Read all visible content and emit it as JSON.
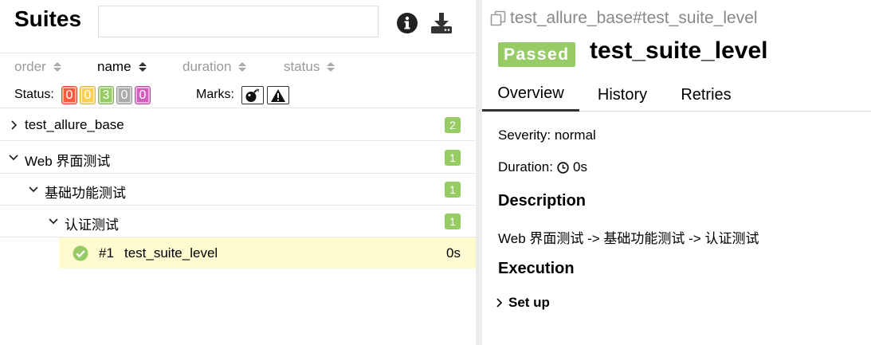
{
  "left": {
    "title": "Suites",
    "search": {
      "value": "",
      "placeholder": ""
    },
    "icons": {
      "info": "info-icon",
      "download": "download-icon"
    },
    "sort": [
      {
        "label": "order",
        "active": false
      },
      {
        "label": "name",
        "active": true
      },
      {
        "label": "duration",
        "active": false
      },
      {
        "label": "status",
        "active": false
      }
    ],
    "status_label": "Status:",
    "status_counts": [
      {
        "value": "0",
        "color": "#fd5a3e"
      },
      {
        "value": "0",
        "color": "#ffd050"
      },
      {
        "value": "3",
        "color": "#97cc64"
      },
      {
        "value": "0",
        "color": "#aaaaaa"
      },
      {
        "value": "0",
        "color": "#d35ebe"
      }
    ],
    "marks_label": "Marks:",
    "marks": [
      "flaky-bomb-icon",
      "warning-icon"
    ],
    "tree": [
      {
        "label": "test_allure_base",
        "count": "2",
        "expanded": false
      },
      {
        "label": "Web 界面测试",
        "count": "1",
        "expanded": true
      },
      {
        "label": "基础功能测试",
        "count": "1",
        "expanded": true
      },
      {
        "label": "认证测试",
        "count": "1",
        "expanded": true
      }
    ],
    "leaf": {
      "number": "#1",
      "name": "test_suite_level",
      "duration": "0s",
      "status": "passed"
    }
  },
  "right": {
    "breadcrumb": "test_allure_base#test_suite_level",
    "status": "Passed",
    "title": "test_suite_level",
    "tabs": [
      "Overview",
      "History",
      "Retries"
    ],
    "severity": "Severity: normal",
    "duration_label": "Duration:",
    "duration_value": "0s",
    "description_title": "Description",
    "description": "Web 界面测试 -> 基础功能测试 -> 认证测试",
    "execution_title": "Execution",
    "setup_label": "Set up"
  },
  "colors": {
    "passed": "#97cc64",
    "selected_row": "#fffbd0"
  }
}
